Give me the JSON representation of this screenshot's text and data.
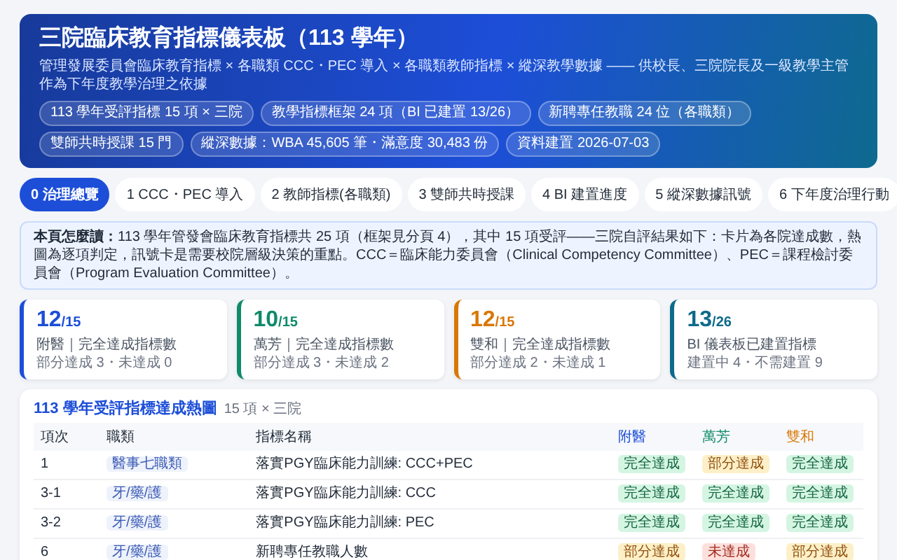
{
  "header": {
    "title": "三院臨床教育指標儀表板（113 學年）",
    "subtitle": "管理發展委員會臨床教育指標 × 各職類 CCC・PEC 導入 × 各職類教師指標 × 縱深教學數據 —— 供校長、三院院長及一級教學主管作為下年度教學治理之依據",
    "pills": [
      "113 學年受評指標 15 項 × 三院",
      "教學指標框架 24 項（BI 已建置 13/26）",
      "新聘專任教職 24 位（各職類）",
      "雙師共時授課 15 門",
      "縱深數據：WBA 45,605 筆・滿意度 30,483 份",
      "資料建置 2026-07-03"
    ]
  },
  "tabs": [
    {
      "label": "0 治理總覽",
      "selected": true
    },
    {
      "label": "1 CCC・PEC 導入",
      "selected": false
    },
    {
      "label": "2 教師指標(各職類)",
      "selected": false
    },
    {
      "label": "3 雙師共時授課",
      "selected": false
    },
    {
      "label": "4 BI 建置進度",
      "selected": false
    },
    {
      "label": "5 縱深數據訊號",
      "selected": false
    },
    {
      "label": "6 下年度治理行動",
      "selected": false
    }
  ],
  "note": "**本頁怎麼讀：**113 學年管發會臨床教育指標共 25 項（框架見分頁 4），其中 15 項受評——三院自評結果如下：卡片為各院達成數，熱圖為逐項判定，訊號卡是需要校院層級決策的重點。CCC＝臨床能力委員會（Clinical Competency Committee）、PEC＝課程檢討委員會（Program Evaluation Committee）。",
  "cards": [
    {
      "value": "12",
      "total": "/15",
      "label": "附醫｜完全達成指標數",
      "detail": "部分達成 3・未達成 0",
      "color": "#1d4ed8"
    },
    {
      "value": "10",
      "total": "/15",
      "label": "萬芳｜完全達成指標數",
      "detail": "部分達成 3・未達成 2",
      "color": "#0f8a6a"
    },
    {
      "value": "12",
      "total": "/15",
      "label": "雙和｜完全達成指標數",
      "detail": "部分達成 2・未達成 1",
      "color": "#d97706"
    },
    {
      "value": "13",
      "total": "/26",
      "label": "BI 儀表板已建置指標",
      "detail": "建置中 4・不需建置 9",
      "color": "#0e6a8a"
    }
  ],
  "heatmap": {
    "title": "113 學年受評指標達成熱圖",
    "subtitle": "15 項 × 三院",
    "columns": [
      {
        "label": "項次"
      },
      {
        "label": "職類"
      },
      {
        "label": "指標名稱"
      },
      {
        "label": "附醫",
        "color": "#1d4ed8"
      },
      {
        "label": "萬芳",
        "color": "#0f8a6a"
      },
      {
        "label": "雙和",
        "color": "#d97706"
      }
    ],
    "rows": [
      {
        "item": "1",
        "category": "醫事七職類",
        "name": "落實PGY臨床能力訓練: CCC+PEC",
        "results": [
          {
            "kind": "full",
            "label": "完全達成"
          },
          {
            "kind": "partial",
            "label": "部分達成"
          },
          {
            "kind": "full",
            "label": "完全達成"
          }
        ]
      },
      {
        "item": "3-1",
        "category": "牙/藥/護",
        "name": "落實PGY臨床能力訓練: CCC",
        "results": [
          {
            "kind": "full",
            "label": "完全達成"
          },
          {
            "kind": "full",
            "label": "完全達成"
          },
          {
            "kind": "full",
            "label": "完全達成"
          }
        ]
      },
      {
        "item": "3-2",
        "category": "牙/藥/護",
        "name": "落實PGY臨床能力訓練: PEC",
        "results": [
          {
            "kind": "full",
            "label": "完全達成"
          },
          {
            "kind": "full",
            "label": "完全達成"
          },
          {
            "kind": "full",
            "label": "完全達成"
          }
        ]
      },
      {
        "item": "6",
        "category": "牙/藥/護",
        "name": "新聘專任教職人數",
        "results": [
          {
            "kind": "partial",
            "label": "部分達成"
          },
          {
            "kind": "none",
            "label": "未達成"
          },
          {
            "kind": "partial",
            "label": "部分達成"
          }
        ]
      }
    ]
  }
}
